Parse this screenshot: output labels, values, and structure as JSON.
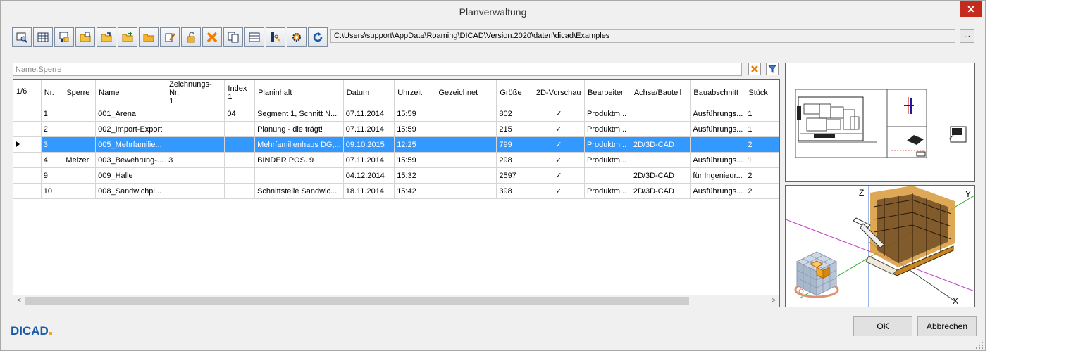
{
  "window": {
    "title": "Planverwaltung",
    "close_label": "✕"
  },
  "toolbar": {
    "buttons": [
      "preview-search",
      "table-view",
      "plan-properties",
      "open-folder",
      "open-folder-edit",
      "open-folder-add",
      "folder-open",
      "edit-document",
      "unlock-folder",
      "delete",
      "copy",
      "list-view",
      "settings-tools",
      "gear",
      "refresh"
    ],
    "path": "C:\\Users\\support\\AppData\\Roaming\\DICAD\\Version.2020\\daten\\dicad\\Examples",
    "browse_label": "..."
  },
  "filter": {
    "placeholder": "Name,Sperre"
  },
  "grid": {
    "counter": "1/6",
    "columns": [
      "Nr.",
      "Sperre",
      "Name",
      "Zeichnungs-Nr.\n1",
      "Index\n1",
      "Planinhalt",
      "Datum",
      "Uhrzeit",
      "Gezeichnet",
      "Größe",
      "2D-Vorschau",
      "Bearbeiter",
      "Achse/Bauteil",
      "Bauabschnitt",
      "Stück"
    ],
    "rows": [
      [
        "1",
        "",
        "001_Arena",
        "",
        "04",
        "Segment 1,  Schnitt N...",
        "07.11.2014",
        "15:59",
        "",
        "802",
        "✓",
        "Produktm...",
        "",
        "Ausführungs...",
        "1"
      ],
      [
        "2",
        "",
        "002_Import-Export",
        "",
        "",
        "Planung - die trägt!",
        "07.11.2014",
        "15:59",
        "",
        "215",
        "✓",
        "Produktm...",
        "",
        "Ausführungs...",
        "1"
      ],
      [
        "3",
        "",
        "005_Mehrfamilie...",
        "",
        "",
        "Mehrfamilienhaus DG,...",
        "09.10.2015",
        "12:25",
        "",
        "799",
        "✓",
        "Produktm...",
        "2D/3D-CAD",
        "",
        "2"
      ],
      [
        "4",
        "Melzer",
        "003_Bewehrung-...",
        "3",
        "",
        "BINDER POS. 9",
        "07.11.2014",
        "15:59",
        "",
        "298",
        "✓",
        "Produktm...",
        "",
        "Ausführungs...",
        "1"
      ],
      [
        "9",
        "",
        "009_Halle",
        "",
        "",
        "",
        "04.12.2014",
        "15:32",
        "",
        "2597",
        "✓",
        "",
        "2D/3D-CAD",
        "für Ingenieur...",
        "2"
      ],
      [
        "10",
        "",
        "008_Sandwichpl...",
        "",
        "",
        "Schnittstelle Sandwic...",
        "18.11.2014",
        "15:42",
        "",
        "398",
        "✓",
        "Produktm...",
        "2D/3D-CAD",
        "Ausführungs...",
        "2"
      ]
    ],
    "selected_row": 2
  },
  "preview3d": {
    "axis_z": "Z",
    "axis_y": "Y",
    "axis_x": "X"
  },
  "footer": {
    "logo": "DICAD",
    "ok_label": "OK",
    "cancel_label": "Abbrechen"
  },
  "colors": {
    "selection": "#3399ff",
    "close": "#c42b1c",
    "logo": "#1a5aa8"
  }
}
